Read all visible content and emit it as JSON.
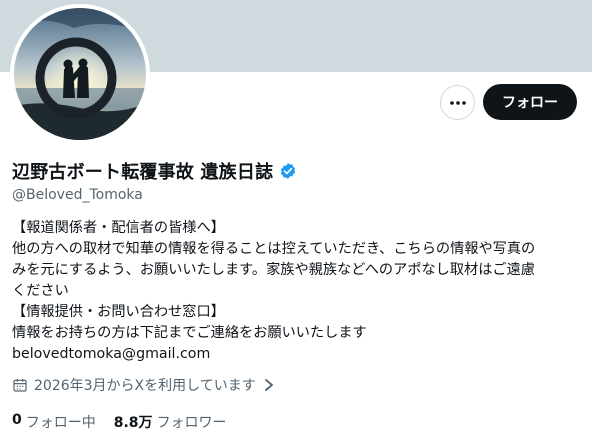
{
  "profile": {
    "display_name": "辺野古ボート転覆事故 遺族日誌",
    "handle": "@Beloved_Tomoka",
    "verified_icon": "verified-badge-icon",
    "bio_lines": [
      "【報道関係者・配信者の皆様へ】",
      "他の方への取材で知華の情報を得ることは控えていただき、こちらの情報や写真の",
      "みを元にするよう、お願いいたします。家族や親族などへのアポなし取材はご遠慮",
      "ください",
      "【情報提供・お問い合わせ窓口】",
      "情報をお持ちの方は下記までご連絡をお願いいたします",
      "belovedtomoka@gmail.com"
    ],
    "joined": "2026年3月からXを利用しています",
    "following_count": "0",
    "following_label": "フォロー中",
    "followers_count": "8.8万",
    "followers_label": "フォロワー"
  },
  "actions": {
    "follow_label": "フォロー",
    "more_icon": "more-dots-icon"
  },
  "colors": {
    "banner": "#cfd9de",
    "verified": "#1d9bf0",
    "text_primary": "#0f1419",
    "text_secondary": "#536471",
    "follow_bg": "#0f1419"
  }
}
